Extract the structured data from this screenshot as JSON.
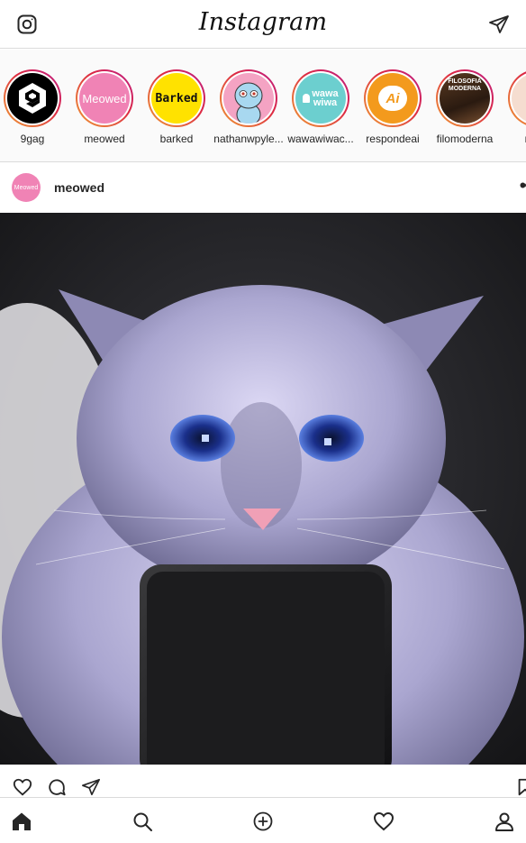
{
  "app": {
    "title": "Instagram",
    "camera_icon": "camera-icon",
    "direct_icon": "paper-plane-icon"
  },
  "stories": [
    {
      "name": "9gag",
      "avatar_text": "9"
    },
    {
      "name": "meowed",
      "avatar_text": "Meowed"
    },
    {
      "name": "barked",
      "avatar_text": "Barked"
    },
    {
      "name": "nathanwpyle...",
      "avatar_text": ""
    },
    {
      "name": "wawawiwac...",
      "avatar_text": "wawa wiwa"
    },
    {
      "name": "respondeai",
      "avatar_text": "Ai"
    },
    {
      "name": "filomoderna",
      "avatar_text": "FILOSOFIA MODERNA"
    },
    {
      "name": "mem",
      "avatar_text": ""
    }
  ],
  "post": {
    "username": "meowed",
    "avatar_text": "Meowed",
    "more_label": "••",
    "actions": [
      "heart-icon",
      "comment-icon",
      "share-icon",
      "bookmark-icon"
    ]
  },
  "tabbar": [
    "home-icon",
    "search-icon",
    "add-icon",
    "activity-heart-icon",
    "profile-icon"
  ],
  "colors": {
    "border": "#dbdbdb",
    "story_ring_start": "#f09433",
    "story_ring_end": "#bc1888",
    "meowed_pink": "#f083b5",
    "barked_yellow": "#ffe200",
    "wawa_teal": "#6ccfcf",
    "respondeai_orange": "#f39a1d"
  }
}
